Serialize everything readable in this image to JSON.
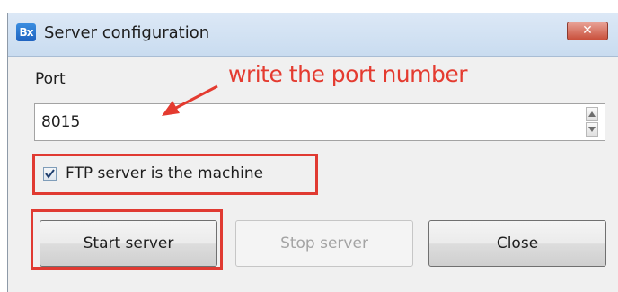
{
  "window": {
    "title": "Server configuration",
    "app_icon_text": "Bx",
    "close_symbol": "✕"
  },
  "form": {
    "port_label": "Port",
    "port_value": "8015",
    "checkbox_label": "FTP server is the machine",
    "checkbox_checked": true
  },
  "buttons": {
    "start": "Start server",
    "stop": "Stop server",
    "stop_enabled": false,
    "close": "Close"
  },
  "annotation": {
    "text": "write the port number",
    "color": "#e43b30"
  },
  "icons": {
    "app": "app-logo-icon",
    "close": "close-icon",
    "spin_up": "caret-up-icon",
    "spin_down": "caret-down-icon",
    "check": "checkmark-icon",
    "arrow": "annotation-arrow-icon"
  },
  "colors": {
    "highlight": "#e03a32",
    "titlebar": "#d3e3f4",
    "close_button": "#c9503c"
  }
}
